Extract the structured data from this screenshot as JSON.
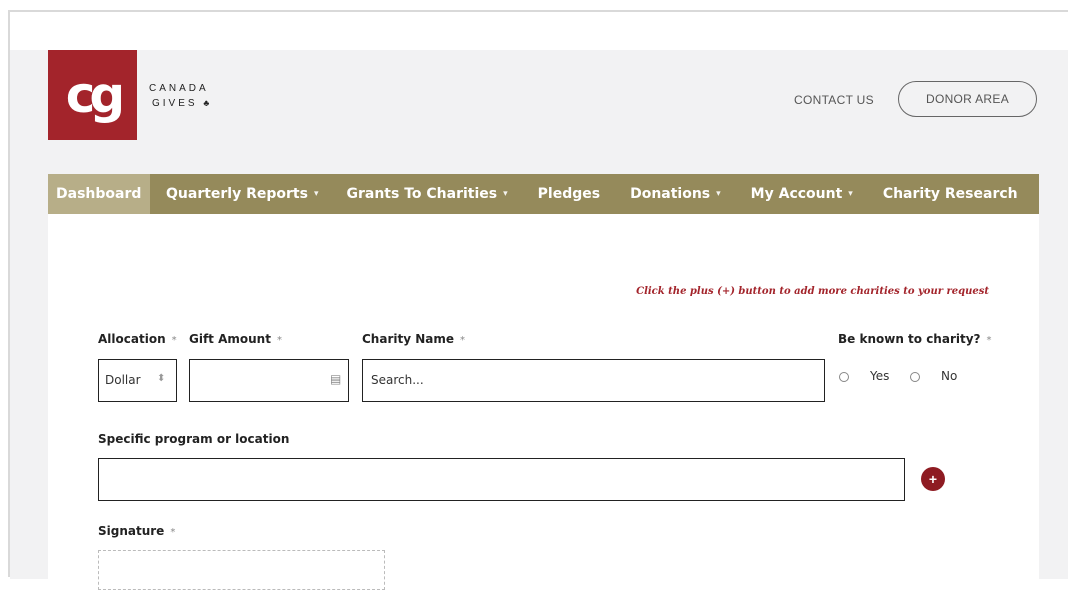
{
  "brand": {
    "logo_mark": "cg",
    "name_line1": "CANADA",
    "name_line2": "GIVES",
    "leaf": "♣"
  },
  "header": {
    "contact_label": "CONTACT US",
    "donor_label": "DONOR AREA"
  },
  "nav": {
    "items": [
      {
        "label": "Dashboard",
        "caret": ""
      },
      {
        "label": "Quarterly Reports",
        "caret": "▾"
      },
      {
        "label": "Grants To Charities",
        "caret": "▾"
      },
      {
        "label": "Pledges",
        "caret": ""
      },
      {
        "label": "Donations",
        "caret": "▾"
      },
      {
        "label": "My Account",
        "caret": "▾"
      },
      {
        "label": "Charity Research",
        "caret": ""
      }
    ]
  },
  "form": {
    "hint": "Click the plus (+) button to add more charities to your request",
    "allocation_label": "Allocation",
    "allocation_value": "Dollar",
    "gift_amount_label": "Gift Amount",
    "gift_amount_value": "",
    "charity_name_label": "Charity Name",
    "charity_name_placeholder": "Search...",
    "known_label": "Be known to charity?",
    "yes_label": "Yes",
    "no_label": "No",
    "program_label": "Specific program or location",
    "program_value": "",
    "plus_label": "+",
    "signature_label": "Signature",
    "required_mark": "*",
    "stepper_glyph": "⬍",
    "card_glyph": "▤"
  },
  "colors": {
    "brand_red": "#a3242b",
    "nav_gold": "#958a5b",
    "nav_active": "#b7ae88"
  }
}
